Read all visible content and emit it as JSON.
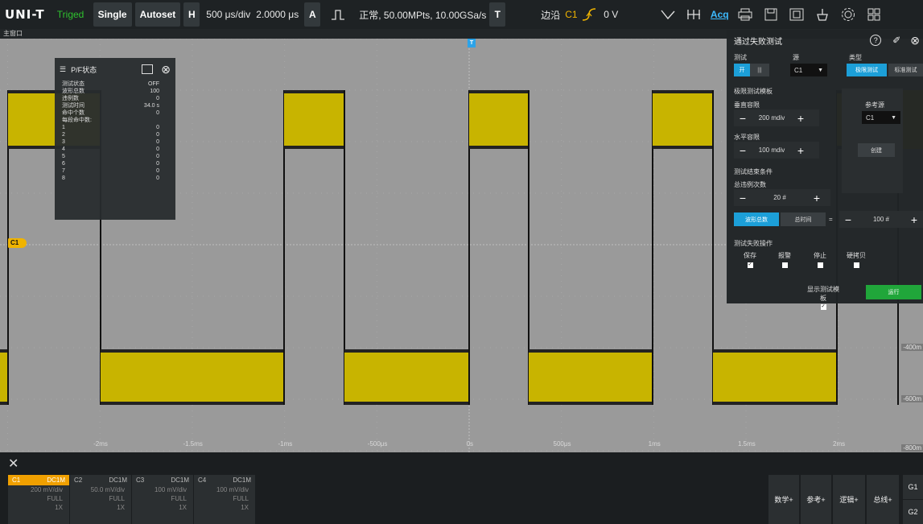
{
  "topbar": {
    "logo": "UNI-T",
    "run_state": "Triged",
    "single": "Single",
    "autoset": "Autoset",
    "h_label": "H",
    "timebase": "500 μs/div",
    "h_offset": "2.0000 μs",
    "a_label": "A",
    "acq_info": "正常, 50.00MPts, 10.00GSa/s",
    "t_label": "T",
    "trigger_type": "边沿",
    "trigger_source": "C1",
    "trigger_level": "0 V",
    "acq_label": "Acq"
  },
  "subbar": {
    "title": "主窗口"
  },
  "scope": {
    "time_labels": [
      "-2ms",
      "-1.5ms",
      "-1ms",
      "-500μs",
      "0s",
      "500μs",
      "1ms",
      "1.5ms",
      "2ms"
    ],
    "c1_marker": "C1",
    "trigger_marker": "T",
    "right_labels": [
      "-400m",
      "-600m",
      "-800m"
    ],
    "trace_color": "#c8b400"
  },
  "pf_panel": {
    "title": "P/F状态",
    "rows": [
      {
        "label": "测试状态",
        "value": "OFF"
      },
      {
        "label": "波形总数",
        "value": "100"
      },
      {
        "label": "违例数",
        "value": "0"
      },
      {
        "label": "测试时间",
        "value": "34.0 s"
      },
      {
        "label": "命中个数",
        "value": "0"
      },
      {
        "label": "每段命中数:",
        "value": ""
      },
      {
        "label": "1",
        "value": "0"
      },
      {
        "label": "2",
        "value": "0"
      },
      {
        "label": "3",
        "value": "0"
      },
      {
        "label": "4",
        "value": "0"
      },
      {
        "label": "5",
        "value": "0"
      },
      {
        "label": "6",
        "value": "0"
      },
      {
        "label": "7",
        "value": "0"
      },
      {
        "label": "8",
        "value": "0"
      }
    ]
  },
  "pass_panel": {
    "title": "通过失败测试",
    "test_label": "测试",
    "test_on": "开",
    "source_label": "源",
    "source_value": "C1",
    "type_label": "类型",
    "type_opts": [
      "极限测试",
      "标准测试"
    ],
    "limit_template": "极限测试模板",
    "vert_tol_label": "垂直容限",
    "vert_tol_value": "200 mdiv",
    "ref_src_label": "参考源",
    "ref_src_value": "C1",
    "horiz_tol_label": "水平容限",
    "horiz_tol_value": "100 mdiv",
    "create_label": "创建",
    "end_cond_label": "测试结束条件",
    "total_viol_label": "总违例次数",
    "total_viol_value": "20 #",
    "cond_opts": [
      "波形总数",
      "总时间"
    ],
    "eq": "=",
    "wave_total_value": "100 #",
    "fail_op_label": "测试失败操作",
    "ops": [
      {
        "label": "保存",
        "checked": true
      },
      {
        "label": "报警",
        "checked": false
      },
      {
        "label": "停止",
        "checked": false
      },
      {
        "label": "硬拷贝",
        "checked": false
      }
    ],
    "show_template_label": "显示测试模板",
    "show_template_checked": true,
    "run_label": "运行"
  },
  "channels": [
    {
      "name": "C1",
      "coupling": "DC1M",
      "scale": "200 mV/div",
      "bw": "FULL",
      "probe": "1X",
      "color": "#f0a000",
      "active": true
    },
    {
      "name": "C2",
      "coupling": "DC1M",
      "scale": "50.0 mV/div",
      "bw": "FULL",
      "probe": "1X",
      "color": "#ccc",
      "active": false
    },
    {
      "name": "C3",
      "coupling": "DC1M",
      "scale": "100 mV/div",
      "bw": "FULL",
      "probe": "1X",
      "color": "#ccc",
      "active": false
    },
    {
      "name": "C4",
      "coupling": "DC1M",
      "scale": "100 mV/div",
      "bw": "FULL",
      "probe": "1X",
      "color": "#ccc",
      "active": false
    }
  ],
  "bottom_buttons": {
    "math": "数学+",
    "ref": "参考+",
    "logic": "逻辑+",
    "bus": "总线+",
    "g1": "G1",
    "g2": "G2"
  }
}
